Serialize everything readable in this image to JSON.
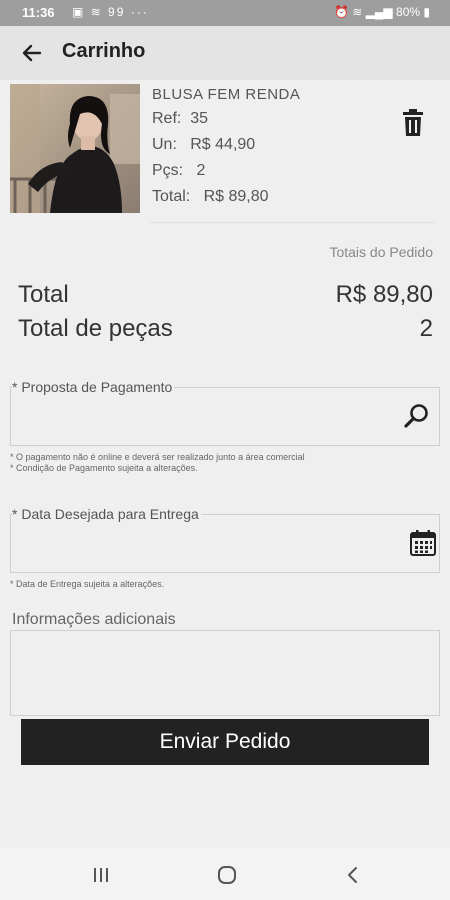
{
  "status_bar": {
    "time": "11:36",
    "left_icons": "▣ ≋ 99 ···",
    "battery": "80%"
  },
  "header": {
    "title": "Carrinho"
  },
  "product": {
    "name": "BLUSA FEM RENDA",
    "ref_label": "Ref:",
    "ref_value": "35",
    "unit_label": "Un:",
    "unit_value": "R$ 44,90",
    "qty_label": "Pçs:",
    "qty_value": "2",
    "total_label": "Total:",
    "total_value": "R$ 89,80"
  },
  "totals": {
    "header": "Totais do Pedido",
    "total_label": "Total",
    "total_value": "R$ 89,80",
    "pieces_label": "Total de peças",
    "pieces_value": "2"
  },
  "payment": {
    "label": "* Proposta de Pagamento",
    "note1": "* O pagamento não é online e deverá ser realizado junto a área comercial",
    "note2": "* Condição de Pagamento sujeita a alterações."
  },
  "delivery": {
    "label": "* Data Desejada para Entrega",
    "note": "* Data de Entrega sujeita a alterações."
  },
  "additional": {
    "label": "Informações adicionais"
  },
  "submit": {
    "label": "Enviar Pedido"
  },
  "icons": [
    "back-arrow-icon",
    "trash-icon",
    "search-icon",
    "calendar-icon",
    "recent-apps-icon",
    "home-icon",
    "back-nav-icon"
  ]
}
